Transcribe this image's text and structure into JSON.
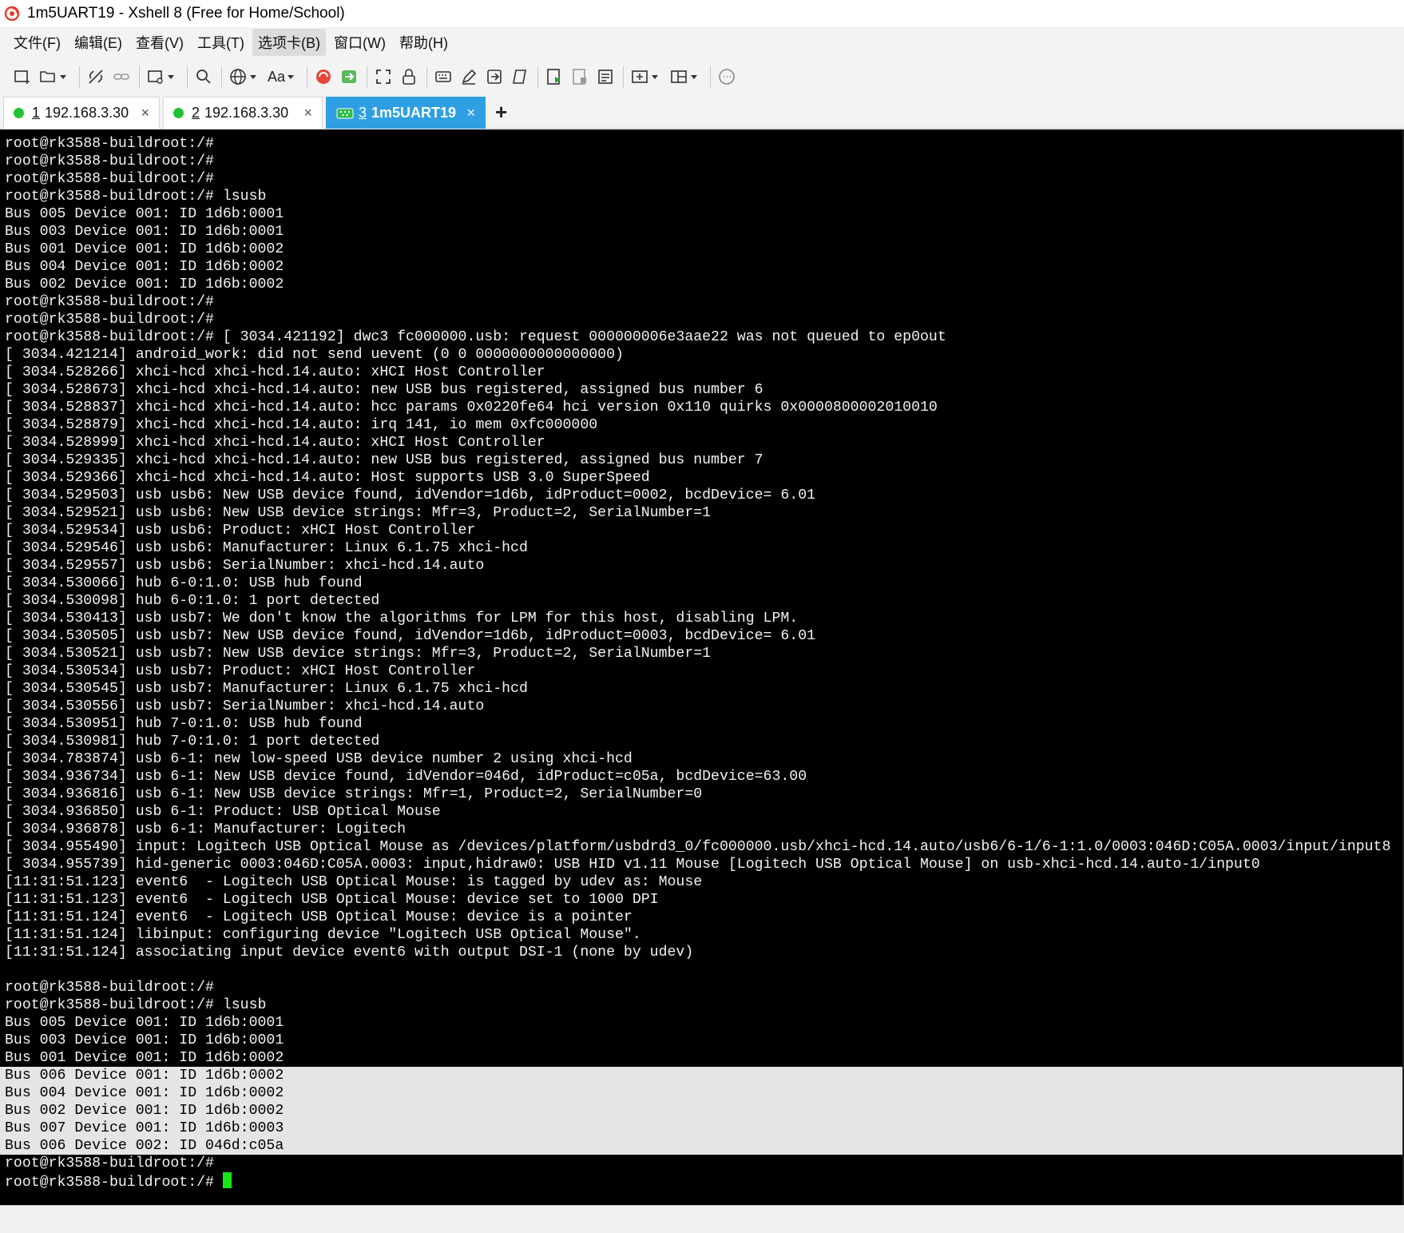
{
  "window": {
    "title": "1m5UART19 - Xshell 8 (Free for Home/School)"
  },
  "menu": [
    {
      "label": "文件(F)"
    },
    {
      "label": "编辑(E)"
    },
    {
      "label": "查看(V)"
    },
    {
      "label": "工具(T)"
    },
    {
      "label": "选项卡(B)"
    },
    {
      "label": "窗口(W)"
    },
    {
      "label": "帮助(H)"
    }
  ],
  "toolbar": {
    "font_label": "Aa",
    "icons": [
      "new-session-icon",
      "open-folder-icon",
      "disconnect-icon",
      "link-icon",
      "new-window-icon",
      "search-icon",
      "globe-icon",
      "font-icon",
      "xshell-icon",
      "xftp-icon",
      "fullscreen-icon",
      "lock-icon",
      "keyboard-icon",
      "compose-icon",
      "transfer-icon",
      "script-icon",
      "run-script-icon",
      "stop-script-icon",
      "log-icon",
      "add-pane-icon",
      "layout-icon",
      "chat-icon"
    ]
  },
  "tabs": [
    {
      "num": "1",
      "label": "192.168.3.30",
      "close": "×",
      "status_color": "#21c232"
    },
    {
      "num": "2",
      "label": "192.168.3.30",
      "close": "×",
      "status_color": "#21c232"
    },
    {
      "num": "3",
      "label": "1m5UART19",
      "close": "×",
      "active": true
    }
  ],
  "tab_add": "+",
  "terminal": {
    "lines": [
      "root@rk3588-buildroot:/#",
      "root@rk3588-buildroot:/#",
      "root@rk3588-buildroot:/#",
      "root@rk3588-buildroot:/# lsusb",
      "Bus 005 Device 001: ID 1d6b:0001",
      "Bus 003 Device 001: ID 1d6b:0001",
      "Bus 001 Device 001: ID 1d6b:0002",
      "Bus 004 Device 001: ID 1d6b:0002",
      "Bus 002 Device 001: ID 1d6b:0002",
      "root@rk3588-buildroot:/#",
      "root@rk3588-buildroot:/#",
      "root@rk3588-buildroot:/# [ 3034.421192] dwc3 fc000000.usb: request 000000006e3aae22 was not queued to ep0out",
      "[ 3034.421214] android_work: did not send uevent (0 0 0000000000000000)",
      "[ 3034.528266] xhci-hcd xhci-hcd.14.auto: xHCI Host Controller",
      "[ 3034.528673] xhci-hcd xhci-hcd.14.auto: new USB bus registered, assigned bus number 6",
      "[ 3034.528837] xhci-hcd xhci-hcd.14.auto: hcc params 0x0220fe64 hci version 0x110 quirks 0x0000800002010010",
      "[ 3034.528879] xhci-hcd xhci-hcd.14.auto: irq 141, io mem 0xfc000000",
      "[ 3034.528999] xhci-hcd xhci-hcd.14.auto: xHCI Host Controller",
      "[ 3034.529335] xhci-hcd xhci-hcd.14.auto: new USB bus registered, assigned bus number 7",
      "[ 3034.529366] xhci-hcd xhci-hcd.14.auto: Host supports USB 3.0 SuperSpeed",
      "[ 3034.529503] usb usb6: New USB device found, idVendor=1d6b, idProduct=0002, bcdDevice= 6.01",
      "[ 3034.529521] usb usb6: New USB device strings: Mfr=3, Product=2, SerialNumber=1",
      "[ 3034.529534] usb usb6: Product: xHCI Host Controller",
      "[ 3034.529546] usb usb6: Manufacturer: Linux 6.1.75 xhci-hcd",
      "[ 3034.529557] usb usb6: SerialNumber: xhci-hcd.14.auto",
      "[ 3034.530066] hub 6-0:1.0: USB hub found",
      "[ 3034.530098] hub 6-0:1.0: 1 port detected",
      "[ 3034.530413] usb usb7: We don't know the algorithms for LPM for this host, disabling LPM.",
      "[ 3034.530505] usb usb7: New USB device found, idVendor=1d6b, idProduct=0003, bcdDevice= 6.01",
      "[ 3034.530521] usb usb7: New USB device strings: Mfr=3, Product=2, SerialNumber=1",
      "[ 3034.530534] usb usb7: Product: xHCI Host Controller",
      "[ 3034.530545] usb usb7: Manufacturer: Linux 6.1.75 xhci-hcd",
      "[ 3034.530556] usb usb7: SerialNumber: xhci-hcd.14.auto",
      "[ 3034.530951] hub 7-0:1.0: USB hub found",
      "[ 3034.530981] hub 7-0:1.0: 1 port detected",
      "[ 3034.783874] usb 6-1: new low-speed USB device number 2 using xhci-hcd",
      "[ 3034.936734] usb 6-1: New USB device found, idVendor=046d, idProduct=c05a, bcdDevice=63.00",
      "[ 3034.936816] usb 6-1: New USB device strings: Mfr=1, Product=2, SerialNumber=0",
      "[ 3034.936850] usb 6-1: Product: USB Optical Mouse",
      "[ 3034.936878] usb 6-1: Manufacturer: Logitech",
      "[ 3034.955490] input: Logitech USB Optical Mouse as /devices/platform/usbdrd3_0/fc000000.usb/xhci-hcd.14.auto/usb6/6-1/6-1:1.0/0003:046D:C05A.0003/input/input8",
      "[ 3034.955739] hid-generic 0003:046D:C05A.0003: input,hidraw0: USB HID v1.11 Mouse [Logitech USB Optical Mouse] on usb-xhci-hcd.14.auto-1/input0",
      "[11:31:51.123] event6  - Logitech USB Optical Mouse: is tagged by udev as: Mouse",
      "[11:31:51.123] event6  - Logitech USB Optical Mouse: device set to 1000 DPI",
      "[11:31:51.124] event6  - Logitech USB Optical Mouse: device is a pointer",
      "[11:31:51.124] libinput: configuring device \"Logitech USB Optical Mouse\".",
      "[11:31:51.124] associating input device event6 with output DSI-1 (none by udev)",
      "",
      "root@rk3588-buildroot:/#",
      "root@rk3588-buildroot:/# lsusb",
      "Bus 005 Device 001: ID 1d6b:0001",
      "Bus 003 Device 001: ID 1d6b:0001",
      "Bus 001 Device 001: ID 1d6b:0002"
    ],
    "selected_lines": [
      "Bus 006 Device 001: ID 1d6b:0002",
      "Bus 004 Device 001: ID 1d6b:0002",
      "Bus 002 Device 001: ID 1d6b:0002",
      "Bus 007 Device 001: ID 1d6b:0003",
      "Bus 006 Device 002: ID 046d:c05a"
    ],
    "after_lines": [
      "root@rk3588-buildroot:/#"
    ],
    "prompt": "root@rk3588-buildroot:/# ",
    "cursor_color": "#19e619"
  }
}
